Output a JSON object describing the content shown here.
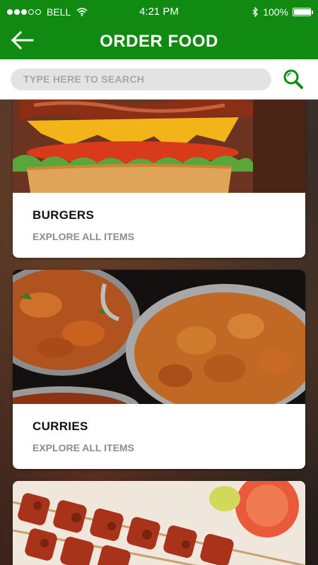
{
  "status_bar": {
    "carrier": "BELL",
    "time": "4:21 PM",
    "battery": "100%",
    "signal_dots_filled": 3,
    "signal_dots_total": 5,
    "battery_level": 1.0
  },
  "header": {
    "title": "ORDER FOOD",
    "back_icon": "arrow-left-icon",
    "background_color": "#108a10"
  },
  "search": {
    "placeholder": "TYPE HERE TO SEARCH",
    "value": "",
    "icon": "search-icon",
    "icon_color": "#108a10"
  },
  "categories": [
    {
      "title": "BURGERS",
      "subtitle": "EXPLORE ALL ITEMS",
      "image": "burger-photo"
    },
    {
      "title": "CURRIES",
      "subtitle": "EXPLORE ALL ITEMS",
      "image": "curry-photo"
    },
    {
      "title": "",
      "subtitle": "",
      "image": "kebab-photo"
    }
  ]
}
